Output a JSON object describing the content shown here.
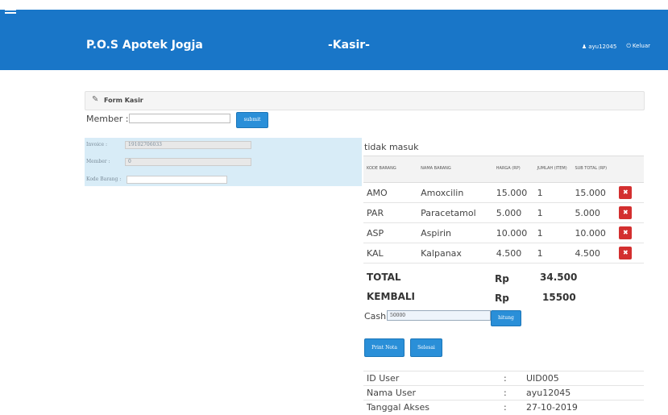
{
  "header": {
    "brand": "P.O.S Apotek Jogja",
    "page": "-Kasir-",
    "user": "ayu12045",
    "logout": "Keluar"
  },
  "panel": {
    "title": "Form Kasir"
  },
  "member_form": {
    "label": "Member :",
    "value": "",
    "submit_label": "submit"
  },
  "invoice": {
    "invoice_label": "Invoice :",
    "invoice_value": "19102706033",
    "member_label": "Member :",
    "member_value": "0",
    "kode_label": "Kode Barang :",
    "kode_value": ""
  },
  "status_text": "tidak masuk",
  "cart": {
    "headers": {
      "kode": "KODE BARANG",
      "nama": "NAMA BARANG",
      "harga": "HARGA (RP)",
      "jumlah": "JUMLAH (ITEM)",
      "subtotal": "SUB TOTAL (RP)"
    },
    "rows": [
      {
        "kode": "AMO",
        "nama": "Amoxcilin",
        "harga": "15.000",
        "jumlah": "1",
        "subtotal": "15.000"
      },
      {
        "kode": "PAR",
        "nama": "Paracetamol",
        "harga": "5.000",
        "jumlah": "1",
        "subtotal": "5.000"
      },
      {
        "kode": "ASP",
        "nama": "Aspirin",
        "harga": "10.000",
        "jumlah": "1",
        "subtotal": "10.000"
      },
      {
        "kode": "KAL",
        "nama": "Kalpanax",
        "harga": "4.500",
        "jumlah": "1",
        "subtotal": "4.500"
      }
    ],
    "delete_glyph": "✖"
  },
  "summary": {
    "total_label": "TOTAL",
    "total_currency": "Rp",
    "total_value": "34.500",
    "kembali_label": "KEMBALI",
    "kembali_currency": "Rp",
    "kembali_value": "15500"
  },
  "cash": {
    "label": "Cash",
    "value": "50000",
    "hitung_label": "hitung"
  },
  "actions": {
    "print_label": "Print Nota",
    "selesai_label": "Selesai"
  },
  "user_info": [
    {
      "label": "ID User",
      "sep": ":",
      "value": "UID005"
    },
    {
      "label": "Nama User",
      "sep": ":",
      "value": "ayu12045"
    },
    {
      "label": "Tanggal Akses",
      "sep": ":",
      "value": "27-10-2019"
    }
  ],
  "colors": {
    "header_bg": "#1976c8",
    "invoice_bg": "#d8ecf7",
    "button_blue": "#2a8fd8",
    "delete_red": "#d32f2f"
  }
}
